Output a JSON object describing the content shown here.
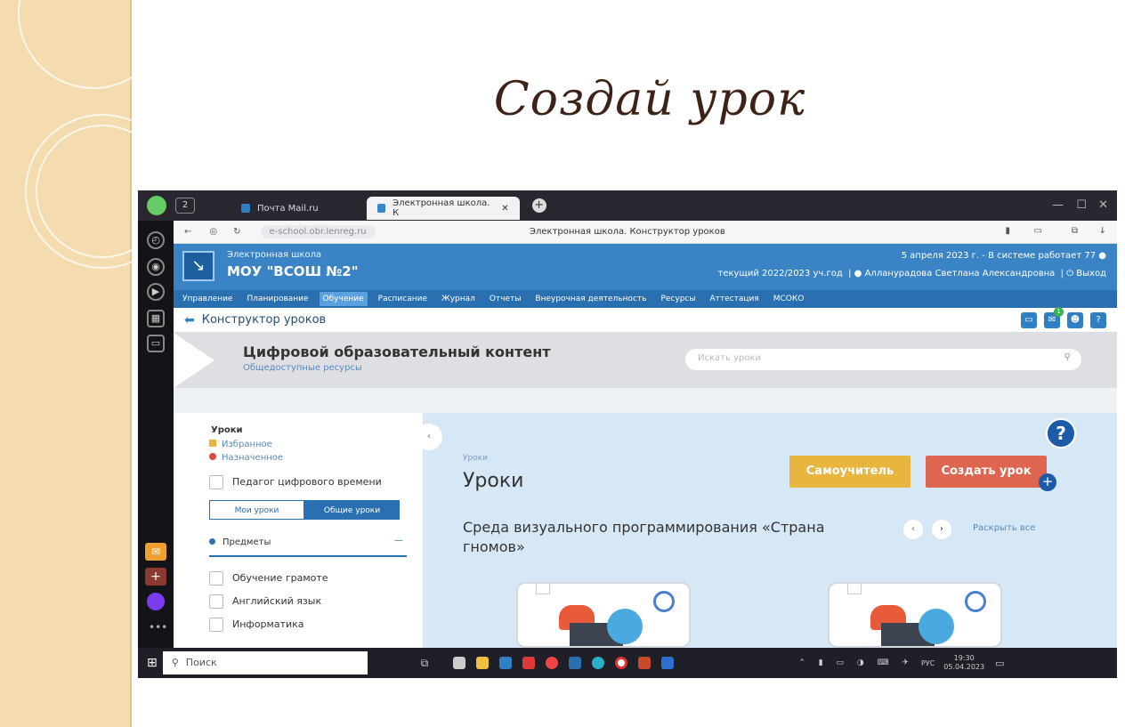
{
  "slide": {
    "title": "Создай урок"
  },
  "browser": {
    "tabs": [
      {
        "label": "Почта Mail.ru",
        "active": false
      },
      {
        "label": "Электронная школа. К",
        "active": true
      }
    ],
    "address_url": "e-school.obr.lenreg.ru",
    "page_title": "Электронная школа. Конструктор уроков"
  },
  "school": {
    "subtitle": "Электронная школа",
    "name": "МОУ \"ВСОШ №2\"",
    "date_info": "5 апреля 2023 г. - В системе работает 77",
    "year_info": "текущий 2022/2023 уч.год",
    "user": "Алланурадова Светлана Александровна",
    "logout": "Выход"
  },
  "menu": {
    "items": [
      {
        "label": "Управление",
        "active": false
      },
      {
        "label": "Планирование",
        "active": false
      },
      {
        "label": "Обучение",
        "active": true
      },
      {
        "label": "Расписание",
        "active": false
      },
      {
        "label": "Журнал",
        "active": false
      },
      {
        "label": "Отчеты",
        "active": false
      },
      {
        "label": "Внеурочная деятельность",
        "active": false
      },
      {
        "label": "Ресурсы",
        "active": false
      },
      {
        "label": "Аттестация",
        "active": false
      },
      {
        "label": "МСОКО",
        "active": false
      }
    ]
  },
  "page": {
    "breadcrumb": "Конструктор уроков",
    "header_badge": "1"
  },
  "banner": {
    "heading": "Цифровой образовательный контент",
    "subheading": "Общедоступные ресурсы",
    "search_placeholder": "Искать уроки"
  },
  "sidebar": {
    "section_title": "Уроки",
    "favorites": "Избранное",
    "assigned": "Назначенное",
    "digital_teacher": "Педагог цифрового времени",
    "tab_my": "Мои уроки",
    "tab_common": "Общие уроки",
    "subjects_title": "Предметы",
    "subjects": [
      "Обучение грамоте",
      "Английский язык",
      "Информатика"
    ]
  },
  "main": {
    "crumb": "Уроки",
    "title": "Уроки",
    "tutorial_button": "Самоучитель",
    "create_button": "Создать урок",
    "section_title": "Среда визуального программирования «Страна гномов»",
    "expand_all": "Раскрыть все"
  },
  "taskbar": {
    "search_placeholder": "Поиск",
    "lang": "РУС",
    "time": "19:30",
    "date": "05.04.2023"
  },
  "colors": {
    "accent_blue": "#3a84c6",
    "tutorial_yellow": "#e8b63f",
    "create_red": "#de6650",
    "slide_beige": "#f4dcb0"
  }
}
